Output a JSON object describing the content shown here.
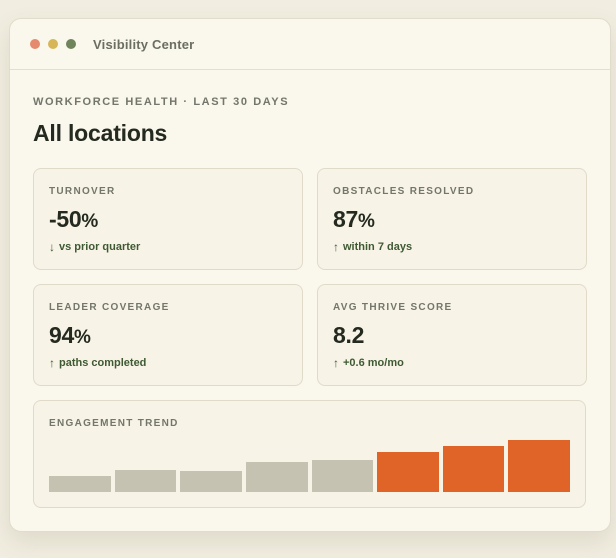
{
  "window": {
    "title": "Visibility Center"
  },
  "header": {
    "eyebrow": "WORKFORCE HEALTH · LAST 30 DAYS",
    "title": "All locations"
  },
  "cards": [
    {
      "label": "TURNOVER",
      "value": "-50",
      "unit": "%",
      "arrow": "↓",
      "sub": "vs prior quarter"
    },
    {
      "label": "OBSTACLES RESOLVED",
      "value": "87",
      "unit": "%",
      "arrow": "↑",
      "sub": "within 7 days"
    },
    {
      "label": "LEADER COVERAGE",
      "value": "94",
      "unit": "%",
      "arrow": "↑",
      "sub": "paths completed"
    },
    {
      "label": "AVG THRIVE SCORE",
      "value": "8.2",
      "unit": "",
      "arrow": "↑",
      "sub": "+0.6 mo/mo"
    }
  ],
  "trend": {
    "label": "ENGAGEMENT TREND"
  },
  "colors": {
    "muted_bar": "#c5c2b2",
    "accent_bar": "#e06428",
    "positive_text": "#3f5a33"
  },
  "chart_data": {
    "type": "bar",
    "title": "ENGAGEMENT TREND",
    "values": [
      0.3,
      0.42,
      0.4,
      0.58,
      0.62,
      0.76,
      0.88,
      1.0
    ],
    "highlighted": [
      false,
      false,
      false,
      false,
      false,
      true,
      true,
      true
    ]
  }
}
